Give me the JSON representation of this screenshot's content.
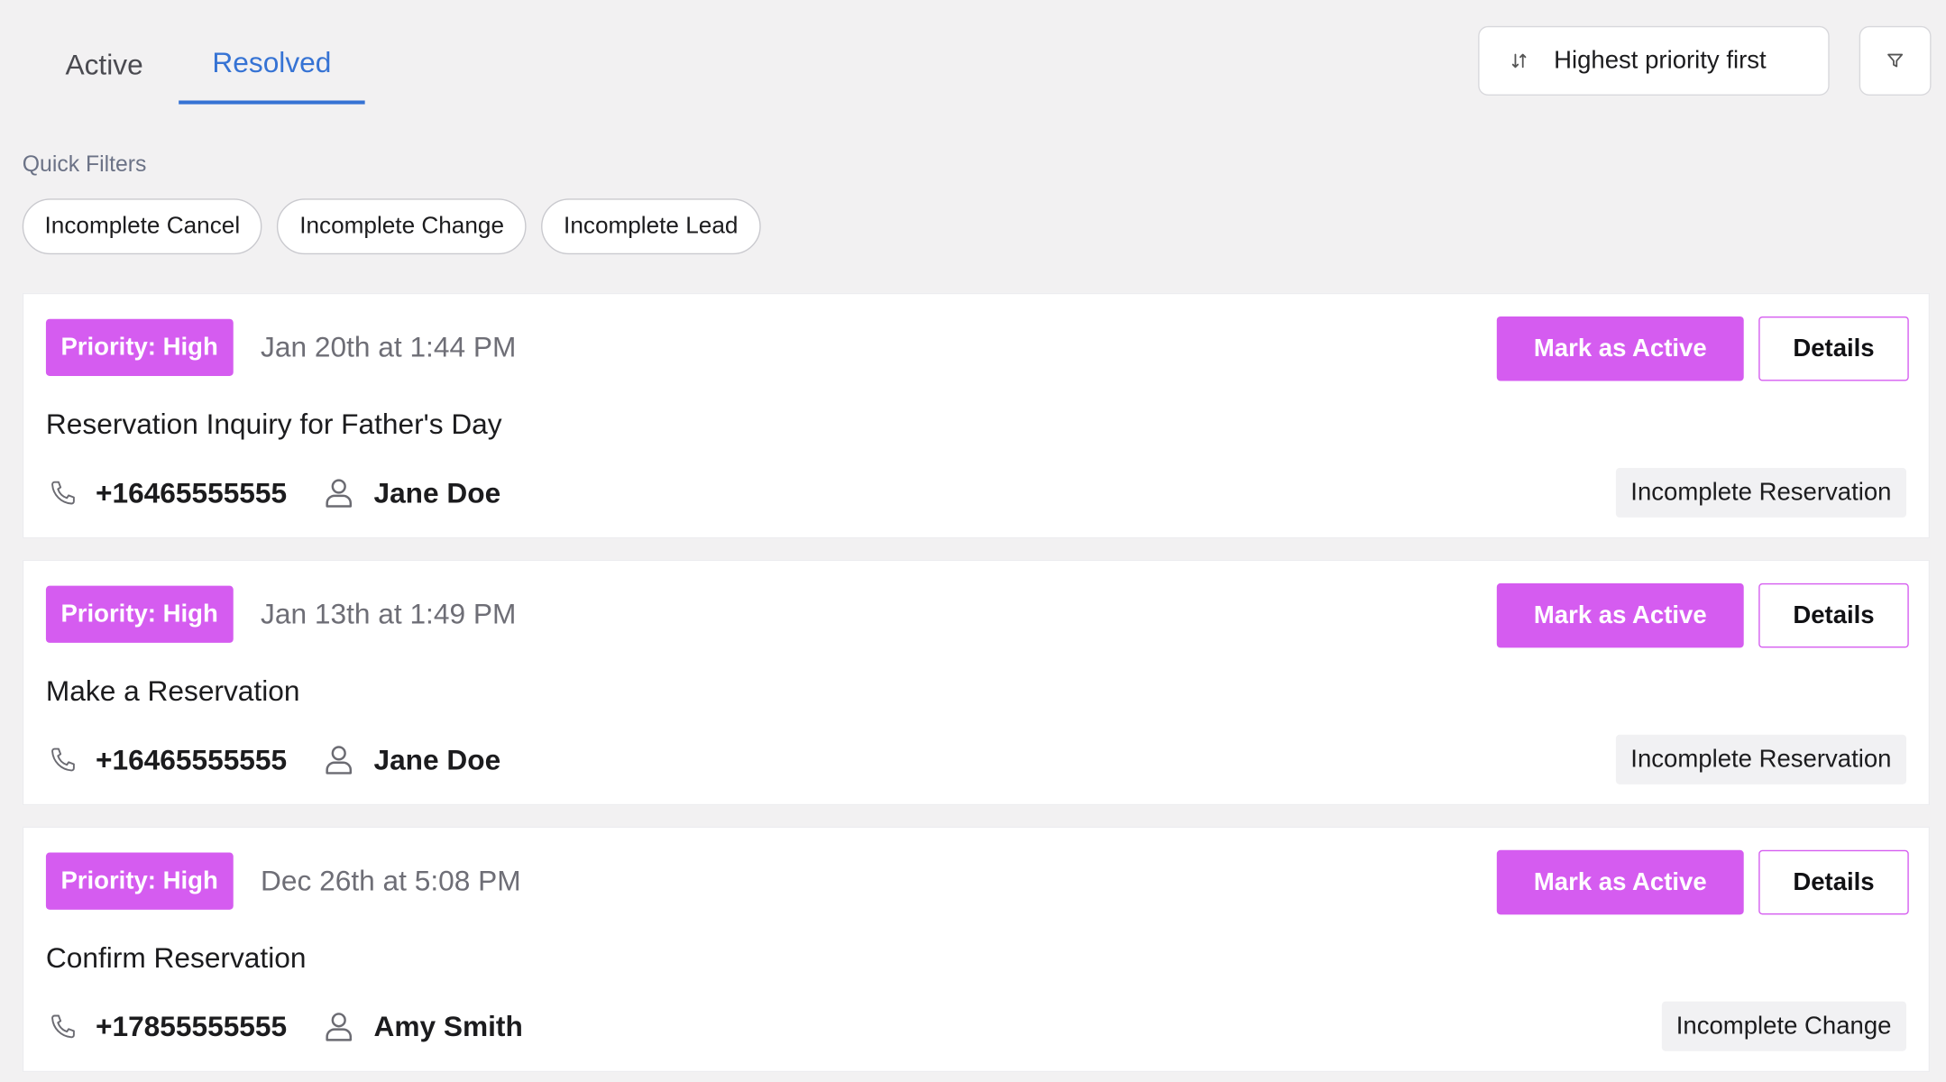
{
  "tabs": [
    {
      "label": "Active",
      "selected": false
    },
    {
      "label": "Resolved",
      "selected": true
    }
  ],
  "sort": {
    "label": "Highest priority first",
    "icon": "sort-arrows-icon"
  },
  "filter": {
    "icon": "funnel-icon"
  },
  "quick_filters": {
    "label": "Quick Filters",
    "chips": [
      "Incomplete Cancel",
      "Incomplete Change",
      "Incomplete Lead"
    ]
  },
  "cards": [
    {
      "priority": "Priority: High",
      "date": "Jan 20th at 1:44 PM",
      "mark_label": "Mark as Active",
      "details_label": "Details",
      "title": "Reservation Inquiry for Father's Day",
      "phone": "+16465555555",
      "person": "Jane Doe",
      "tag": "Incomplete Reservation"
    },
    {
      "priority": "Priority: High",
      "date": "Jan 13th at 1:49 PM",
      "mark_label": "Mark as Active",
      "details_label": "Details",
      "title": "Make a Reservation",
      "phone": "+16465555555",
      "person": "Jane Doe",
      "tag": "Incomplete Reservation"
    },
    {
      "priority": "Priority: High",
      "date": "Dec 26th at 5:08 PM",
      "mark_label": "Mark as Active",
      "details_label": "Details",
      "title": "Confirm Reservation",
      "phone": "+17855555555",
      "person": "Amy Smith",
      "tag": "Incomplete Change"
    }
  ],
  "colors": {
    "accent_purple": "#d55cf0",
    "tab_blue": "#3673d4",
    "background": "#f2f1f2"
  }
}
